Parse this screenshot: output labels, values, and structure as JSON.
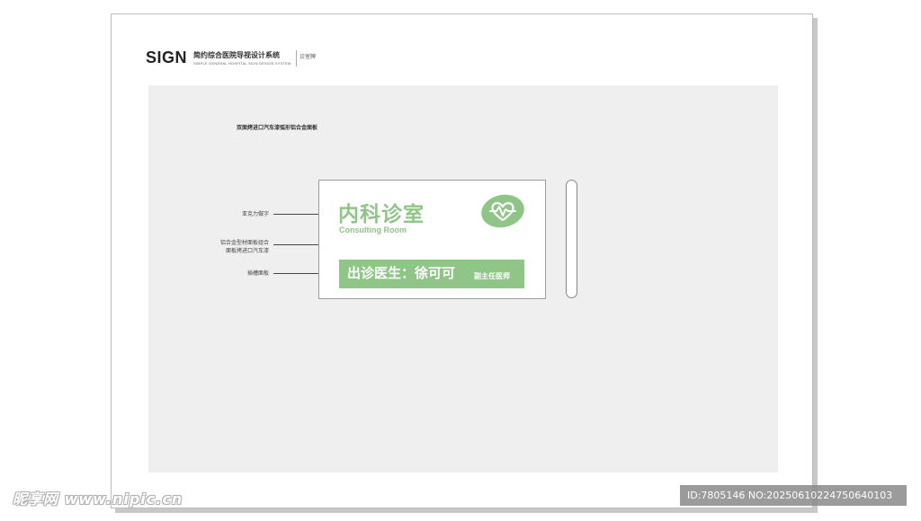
{
  "header": {
    "sign_label": "SIGN",
    "system_title_cn": "简约综合医院导视设计系统",
    "system_title_en": "SIMPLE GENERAL HOSPITAL SIGN DESIGN SYSTEM",
    "page_tag": "诊室牌"
  },
  "canvas": {
    "title": "双面烤进口汽车漆弧形铝合金面板"
  },
  "callouts": {
    "acrylic": "亚克力做字",
    "aluminum_line1": "铝合金型材面板组合",
    "aluminum_line2": "面板烤进口汽车漆",
    "slot_panel": "插槽面板"
  },
  "sign": {
    "room_cn": "内科诊室",
    "room_en": "Consulting Room",
    "doctor_label": "出诊医生：徐可可",
    "doctor_title": "副主任医师",
    "logo_icon": "heart-pulse-icon"
  },
  "colors": {
    "accent_green": "#8fc586",
    "canvas_gray": "#efefef"
  },
  "watermark": {
    "left_text": "昵享网 www.nipic.cn",
    "right_text": "ID:7805146 NO:20250610224750640103"
  }
}
